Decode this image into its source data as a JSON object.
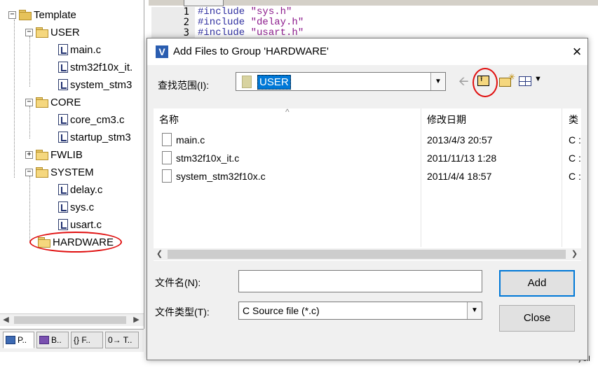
{
  "project_tree": {
    "root": "Template",
    "groups": [
      {
        "label": "USER",
        "files": [
          "main.c",
          "stm32f10x_it.",
          "system_stm3"
        ]
      },
      {
        "label": "CORE",
        "files": [
          "core_cm3.c",
          "startup_stm3"
        ]
      },
      {
        "label": "FWLIB",
        "files": []
      },
      {
        "label": "SYSTEM",
        "files": [
          "delay.c",
          "sys.c",
          "usart.c"
        ]
      },
      {
        "label": "HARDWARE",
        "files": []
      }
    ],
    "tabs": [
      "P..",
      "B..",
      "{} F..",
      "0→ T.."
    ]
  },
  "editor": {
    "line_numbers": [
      "1",
      "2",
      "3"
    ],
    "lines": [
      {
        "kw": "#include ",
        "str": "\"sys.h\""
      },
      {
        "kw": "#include ",
        "str": "\"delay.h\""
      },
      {
        "kw": "#include ",
        "str": "\"usart.h\""
      }
    ]
  },
  "dialog": {
    "title": "Add Files to Group 'HARDWARE'",
    "look_in_label": "查找范围(I):",
    "look_in_value": "USER",
    "columns": {
      "name": "名称",
      "date": "修改日期",
      "type": "类"
    },
    "files": [
      {
        "name": "main.c",
        "date": "2013/4/3 20:57",
        "type": "C :"
      },
      {
        "name": "stm32f10x_it.c",
        "date": "2011/11/13 1:28",
        "type": "C :"
      },
      {
        "name": "system_stm32f10x.c",
        "date": "2011/4/4 18:57",
        "type": "C :"
      }
    ],
    "filename_label": "文件名(N):",
    "filename_value": "",
    "filetype_label": "文件类型(T):",
    "filetype_value": "C Source file (*.c)",
    "add_button": "Add",
    "close_button": "Close"
  },
  "colors": {
    "accent": "#0078d7",
    "annotation_red": "#e01010",
    "folder": "#f5d77e"
  },
  "right_fragment": "ʃ-ell"
}
